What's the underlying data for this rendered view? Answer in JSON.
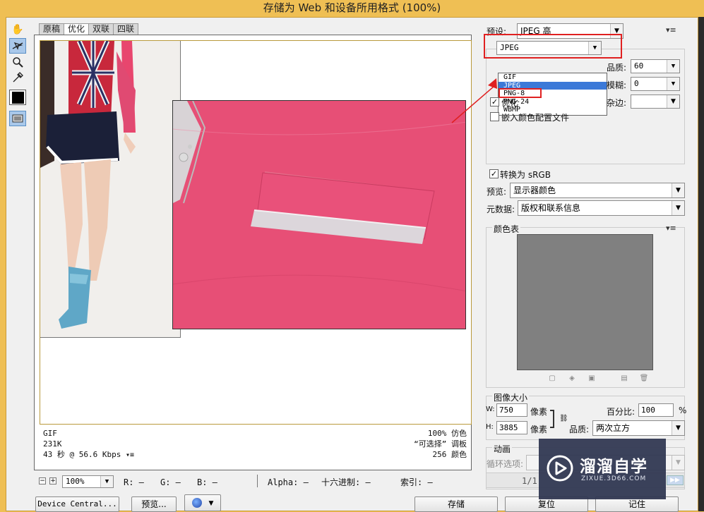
{
  "title": "存储为 Web 和设备所用格式 (100%)",
  "tabs": [
    "原稿",
    "优化",
    "双联",
    "四联"
  ],
  "tools": [
    "hand-tool",
    "slice-select-tool",
    "zoom-tool",
    "eyedropper-tool",
    "eyedropper-color",
    "toggle-slices"
  ],
  "status": {
    "format": "GIF",
    "size": "231K",
    "time": "43 秒 @ 56.6 Kbps",
    "dither": "100% 仿色",
    "palette": "“可选择” 调板",
    "colors": "256 颜色"
  },
  "bottombar": {
    "zoom": "100%",
    "r": "R: —",
    "g": "G: —",
    "b": "B: —",
    "alpha": "Alpha: —",
    "hex": "十六进制: —",
    "index": "索引: —"
  },
  "buttons": {
    "device_central": "Device Central...",
    "preview": "预览...",
    "save": "存储",
    "reset": "复位",
    "remember": "记住"
  },
  "settings": {
    "preset_label": "预设:",
    "preset_value": "JPEG 高",
    "format_value": "JPEG",
    "format_options": [
      "GIF",
      "JPEG",
      "PNG-8",
      "PNG-24",
      "WBMP"
    ],
    "format_selected_index": 1,
    "quality_label": "品质:",
    "quality_value": "60",
    "blur_label": "模糊:",
    "blur_value": "0",
    "matte_label": "杂边:",
    "optimized_label": "优化",
    "embed_profile_label": "嵌入颜色配置文件",
    "convert_srgb_label": "转换为 sRGB",
    "preview_label": "预览:",
    "preview_value": "显示器颜色",
    "metadata_label": "元数据:",
    "metadata_value": "版权和联系信息"
  },
  "color_table": {
    "title": "颜色表"
  },
  "image_size": {
    "title": "图像大小",
    "w_label": "W:",
    "w_value": "750",
    "h_label": "H:",
    "h_value": "3885",
    "unit": "像素",
    "percent_label": "百分比:",
    "percent_value": "100",
    "percent_sign": "%",
    "quality_label": "品质:",
    "quality_value": "两次立方"
  },
  "animation": {
    "title": "动画",
    "loop_label": "循环选项:",
    "frame_counter": "1/1"
  },
  "watermark": {
    "brand": "溜溜自学",
    "url": "ZIXUE.3D66.COM"
  },
  "colors": {
    "titlebar": "#efbf54",
    "highlight_red": "#e02020",
    "selection_blue": "#3b79d8",
    "sweater_pink": "#e8466e"
  }
}
